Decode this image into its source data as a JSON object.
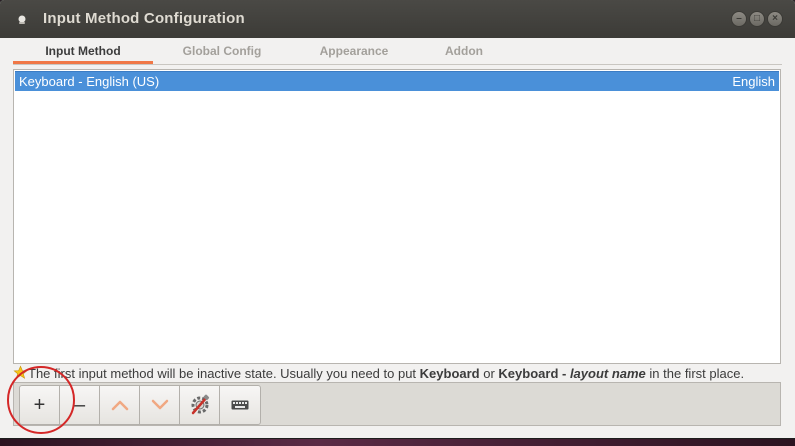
{
  "window": {
    "title": "Input Method Configuration",
    "buttons": {
      "minimize": "–",
      "maximize": "□",
      "close": "×"
    }
  },
  "tabs": [
    {
      "label": "Input Method",
      "active": true
    },
    {
      "label": "Global Config",
      "active": false
    },
    {
      "label": "Appearance",
      "active": false
    },
    {
      "label": "Addon",
      "active": false
    }
  ],
  "input_methods": [
    {
      "name": "Keyboard - English (US)",
      "language": "English",
      "selected": true
    }
  ],
  "hint": {
    "icon": "star-icon",
    "part1": "The first input method will be inactive state. Usually you need to put ",
    "bold1": "Keyboard",
    "part2": " or ",
    "bold2": "Keyboard - ",
    "italic": "layout name",
    "part3": " in the first place."
  },
  "toolbar": {
    "add": "+",
    "remove": "–",
    "icons": [
      "plus-icon",
      "minus-icon",
      "chevron-up-icon",
      "chevron-down-icon",
      "configure-icon",
      "keyboard-icon"
    ]
  },
  "colors": {
    "selection": "#4a90d9",
    "active_tab_underline": "#f07746",
    "annotation": "#d42727"
  }
}
